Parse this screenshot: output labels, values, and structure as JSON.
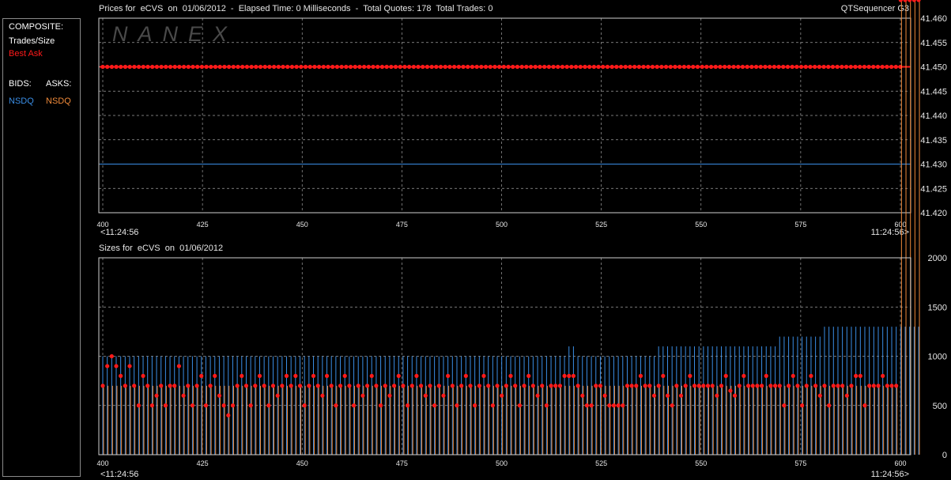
{
  "header": {
    "price_title": "Prices for  eCVS  on  01/06/2012  -  Elapsed Time: 0 Milliseconds  -  Total Quotes: 178  Total Trades: 0",
    "app_name": "QTSequencer G3",
    "size_title": "Sizes for  eCVS  on  01/06/2012",
    "watermark": "NANEX"
  },
  "legend": {
    "composite": "COMPOSITE:",
    "trades_size": "Trades/Size",
    "best_ask": "Best Ask",
    "bids": "BIDS:",
    "asks": "ASKS:",
    "bid_exchange": "NSDQ",
    "ask_exchange": "NSDQ"
  },
  "colors": {
    "background": "#000000",
    "grid": "#c8c8c8",
    "best_ask": "#ff1a1a",
    "bid": "#3a8ee6",
    "ask": "#f08a3a",
    "trades": "#ffffff"
  },
  "chart_data": [
    {
      "type": "line",
      "title": "Prices for  eCVS  on  01/06/2012  -  Elapsed Time: 0 Milliseconds  -  Total Quotes: 178  Total Trades: 0",
      "xlim": [
        400,
        600
      ],
      "ylim": [
        41.42,
        41.46
      ],
      "x_ticks": [
        "400",
        "425",
        "450",
        "475",
        "500",
        "525",
        "550",
        "575",
        "600"
      ],
      "y_ticks": [
        "41.460",
        "41.455",
        "41.450",
        "41.445",
        "41.440",
        "41.435",
        "41.430",
        "41.425",
        "41.420"
      ],
      "x_start_time": "<11:24:56",
      "x_end_time": "11:24:56>",
      "grid": true,
      "series": [
        {
          "name": "Best Ask",
          "color": "#ff1a1a",
          "y_constant": 41.45,
          "x_range": [
            400,
            600
          ],
          "markers": true
        },
        {
          "name": "NSDQ",
          "color": "#3a8ee6",
          "y_constant": 41.43,
          "x_range": [
            400,
            600
          ],
          "markers": false
        }
      ]
    },
    {
      "type": "bar",
      "title": "Sizes for  eCVS  on  01/06/2012",
      "xlim": [
        400,
        600
      ],
      "ylim": [
        0,
        2000
      ],
      "x_ticks": [
        "400",
        "425",
        "450",
        "475",
        "500",
        "525",
        "550",
        "575",
        "600"
      ],
      "y_ticks": [
        "2000",
        "1500",
        "1000",
        "500",
        "0"
      ],
      "x_start_time": "<11:24:56",
      "x_end_time": "11:24:56>",
      "grid": true,
      "x_start": 400,
      "x_step": 1.124,
      "series": [
        {
          "name": "NSDQ",
          "color": "#3a8ee6",
          "values": [
            1000,
            1000,
            1000,
            1000,
            1000,
            1000,
            1000,
            1000,
            1000,
            1000,
            1000,
            1000,
            1000,
            1000,
            1000,
            1000,
            1000,
            1000,
            1000,
            1000,
            1000,
            1000,
            1000,
            1000,
            1000,
            1000,
            1000,
            1000,
            1000,
            1000,
            1000,
            1000,
            1000,
            1000,
            1000,
            1000,
            1000,
            1000,
            1000,
            1000,
            1000,
            1000,
            1000,
            1000,
            1000,
            1000,
            1000,
            1000,
            1000,
            1000,
            1000,
            1000,
            1000,
            1000,
            1000,
            1000,
            1000,
            1000,
            1000,
            1000,
            1000,
            1000,
            1000,
            1000,
            1000,
            1000,
            1000,
            1000,
            1000,
            1000,
            1000,
            1000,
            1000,
            1000,
            1000,
            1000,
            1000,
            1000,
            1000,
            1000,
            1000,
            1000,
            1000,
            1000,
            1000,
            1000,
            1000,
            1000,
            1000,
            1000,
            1000,
            1000,
            1000,
            1000,
            1000,
            1000,
            1000,
            1000,
            1000,
            1000,
            1000,
            1000,
            1000,
            1000,
            1100,
            1100,
            1000,
            1000,
            1000,
            1000,
            1000,
            1000,
            1000,
            1000,
            1000,
            1000,
            1000,
            1000,
            1000,
            1000,
            1000,
            1000,
            1000,
            1000,
            1100,
            1100,
            1100,
            1100,
            1100,
            1100,
            1100,
            1100,
            1100,
            1100,
            1100,
            1100,
            1100,
            1100,
            1100,
            1100,
            1100,
            1100,
            1100,
            1100,
            1100,
            1100,
            1100,
            1100,
            1100,
            1100,
            1100,
            1200,
            1200,
            1200,
            1200,
            1200,
            1200,
            1200,
            1200,
            1200,
            1200,
            1300,
            1300,
            1300,
            1300,
            1300,
            1300,
            1300,
            1300,
            1300,
            1300,
            1300,
            1300,
            1300,
            1300,
            1300,
            1300,
            1300,
            1300,
            1300,
            1300,
            1300,
            1300
          ]
        },
        {
          "name": "NSDQ",
          "color": "#f08a3a",
          "values": [
            700,
            700,
            700,
            700,
            700,
            700,
            700,
            700,
            700,
            700,
            700,
            700,
            700,
            700,
            700,
            700,
            700,
            700,
            700,
            700,
            700,
            700,
            700,
            700,
            700,
            700,
            700,
            700,
            700,
            700,
            700,
            700,
            700,
            700,
            700,
            700,
            700,
            700,
            700,
            700,
            700,
            700,
            700,
            700,
            700,
            700,
            700,
            700,
            700,
            700,
            700,
            700,
            700,
            700,
            700,
            700,
            700,
            700,
            700,
            700,
            700,
            700,
            700,
            700,
            700,
            700,
            700,
            700,
            700,
            700,
            700,
            700,
            700,
            700,
            700,
            700,
            700,
            700,
            700,
            700,
            700,
            700,
            700,
            700,
            700,
            700,
            700,
            700,
            700,
            700,
            700,
            700,
            700,
            700,
            700,
            700,
            700,
            700,
            700,
            700,
            700,
            700,
            700,
            700,
            700,
            700,
            700,
            700,
            700,
            700,
            700,
            700,
            700,
            700,
            700,
            700,
            700,
            700,
            700,
            700,
            700,
            700,
            700,
            700,
            700,
            700,
            700,
            700,
            700,
            700,
            700,
            700,
            700,
            700,
            700,
            700,
            700,
            700,
            700,
            700,
            700,
            700,
            700,
            700,
            700,
            700,
            700,
            700,
            700,
            700,
            700,
            700,
            700,
            700,
            700,
            700,
            700,
            700,
            700,
            700,
            700,
            700,
            700,
            700,
            700,
            700,
            700,
            700,
            700,
            700,
            700,
            700,
            700,
            700,
            700,
            700,
            700,
            700
          ]
        },
        {
          "name": "Trades/Size",
          "color": "#ff1a1a",
          "values": [
            700,
            900,
            1000,
            900,
            800,
            700,
            900,
            700,
            500,
            800,
            700,
            500,
            600,
            700,
            500,
            700,
            700,
            900,
            600,
            700,
            500,
            700,
            800,
            500,
            700,
            800,
            600,
            500,
            400,
            500,
            700,
            800,
            700,
            500,
            700,
            800,
            700,
            500,
            700,
            600,
            700,
            800,
            700,
            800,
            700,
            500,
            700,
            800,
            700,
            600,
            800,
            700,
            500,
            700,
            800,
            700,
            500,
            700,
            600,
            700,
            800,
            700,
            500,
            700,
            600,
            700,
            800,
            700,
            500,
            700,
            800,
            700,
            600,
            700,
            500,
            700,
            600,
            800,
            700,
            500,
            700,
            800,
            700,
            500,
            700,
            800,
            700,
            500,
            700,
            600,
            700,
            800,
            700,
            500,
            700,
            800,
            700,
            600,
            700,
            500,
            700,
            700,
            700,
            800,
            800,
            800,
            700,
            600,
            500,
            500,
            700,
            700,
            600,
            500,
            500,
            500,
            500,
            700,
            700,
            700,
            800,
            700,
            700,
            600,
            700,
            800,
            600,
            500,
            700,
            600,
            700,
            800,
            700,
            700,
            700,
            700,
            700,
            600,
            700,
            800,
            650,
            600,
            700,
            800,
            700,
            700,
            700,
            700,
            800,
            700,
            700,
            700,
            500,
            700,
            800,
            700,
            500,
            700,
            800,
            700,
            600,
            700,
            500,
            700,
            700,
            700,
            600,
            700,
            800,
            800,
            500,
            700,
            700,
            700,
            800,
            700,
            700,
            700
          ]
        }
      ]
    }
  ]
}
